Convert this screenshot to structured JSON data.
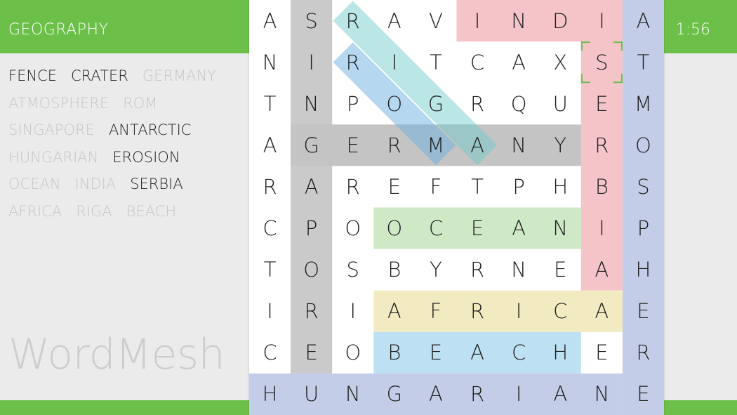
{
  "header": {
    "category": "GEOGRAPHY",
    "timer": "1:56"
  },
  "logo": "WordMesh",
  "words": [
    [
      {
        "text": "FENCE",
        "found": false
      },
      {
        "text": "CRATER",
        "found": false
      },
      {
        "text": "GERMANY",
        "found": true
      }
    ],
    [
      {
        "text": "ATMOSPHERE",
        "found": true
      },
      {
        "text": "ROM",
        "found": true
      }
    ],
    [
      {
        "text": "SINGAPORE",
        "found": true
      },
      {
        "text": "ANTARCTIC",
        "found": false
      }
    ],
    [
      {
        "text": "HUNGARIAN",
        "found": true
      },
      {
        "text": "EROSION",
        "found": false
      }
    ],
    [
      {
        "text": "OCEAN",
        "found": true
      },
      {
        "text": "INDIA",
        "found": true
      },
      {
        "text": "SERBIA",
        "found": false
      }
    ],
    [
      {
        "text": "AFRICA",
        "found": true
      },
      {
        "text": "RIGA",
        "found": true
      },
      {
        "text": "BEACH",
        "found": true
      }
    ]
  ],
  "grid": [
    [
      "A",
      "S",
      "R",
      "A",
      "V",
      "I",
      "N",
      "D",
      "I",
      "A"
    ],
    [
      "N",
      "I",
      "R",
      "I",
      "T",
      "C",
      "A",
      "X",
      "S",
      "T"
    ],
    [
      "T",
      "N",
      "P",
      "O",
      "G",
      "R",
      "Q",
      "U",
      "E",
      "M"
    ],
    [
      "A",
      "G",
      "E",
      "R",
      "M",
      "A",
      "N",
      "Y",
      "R",
      "O"
    ],
    [
      "R",
      "A",
      "R",
      "E",
      "F",
      "T",
      "P",
      "H",
      "B",
      "S"
    ],
    [
      "C",
      "P",
      "O",
      "O",
      "C",
      "E",
      "A",
      "N",
      "I",
      "P"
    ],
    [
      "T",
      "O",
      "S",
      "B",
      "Y",
      "R",
      "N",
      "E",
      "A",
      "H"
    ],
    [
      "I",
      "R",
      "I",
      "A",
      "F",
      "R",
      "I",
      "C",
      "A",
      "E"
    ],
    [
      "C",
      "E",
      "O",
      "B",
      "E",
      "A",
      "C",
      "H",
      "E",
      "R"
    ],
    [
      "H",
      "U",
      "N",
      "G",
      "A",
      "R",
      "I",
      "A",
      "N",
      "E"
    ]
  ],
  "highlights": [
    {
      "word": "INDIA",
      "type": "rect",
      "color": "#f4c4c8",
      "start": [
        0,
        5
      ],
      "end": [
        0,
        9
      ]
    },
    {
      "word": "ATMOSPHERE",
      "type": "rect",
      "color": "#c3cde8",
      "start": [
        0,
        9
      ],
      "end": [
        9,
        9
      ]
    },
    {
      "word": "SERBIA",
      "type": "rect",
      "color": "#f4c4c8",
      "start": [
        1,
        8
      ],
      "end": [
        6,
        8
      ]
    },
    {
      "word": "SINGAPORE",
      "type": "rect",
      "color": "#cacaca",
      "start": [
        0,
        1
      ],
      "end": [
        8,
        1
      ]
    },
    {
      "word": "GERMANY",
      "type": "rect",
      "color": "#c4c4c4",
      "start": [
        3,
        1
      ],
      "end": [
        3,
        7
      ]
    },
    {
      "word": "OCEAN",
      "type": "rect",
      "color": "#cfe9c6",
      "start": [
        5,
        3
      ],
      "end": [
        5,
        7
      ]
    },
    {
      "word": "AFRICA",
      "type": "rect",
      "color": "#f2ebc2",
      "start": [
        7,
        3
      ],
      "end": [
        7,
        8
      ]
    },
    {
      "word": "BEACH",
      "type": "rect",
      "color": "#bde0f2",
      "start": [
        8,
        3
      ],
      "end": [
        8,
        7
      ]
    },
    {
      "word": "HUNGARIAN",
      "type": "rect",
      "color": "#c3cde8",
      "start": [
        9,
        0
      ],
      "end": [
        9,
        8
      ]
    },
    {
      "word": "RIGA",
      "type": "diag",
      "color": "rgba(110,175,225,0.50)",
      "start": [
        1,
        2
      ],
      "end": [
        3,
        4
      ]
    },
    {
      "word": "ROM",
      "type": "diag",
      "color": "rgba(110,205,200,0.48)",
      "start": [
        0,
        2
      ],
      "end": [
        3,
        5
      ]
    }
  ],
  "cursor": {
    "row": 1,
    "col": 8,
    "color": "#6cc04a"
  }
}
